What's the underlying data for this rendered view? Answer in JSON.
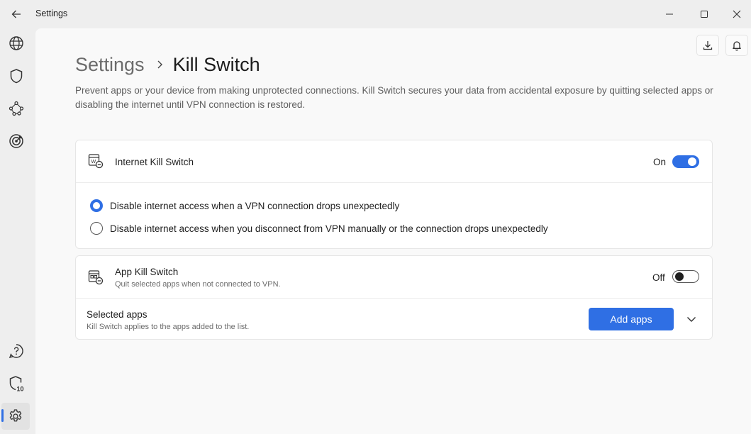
{
  "window": {
    "title": "Settings",
    "back_icon": "arrow-left-icon",
    "controls": [
      "minimize-icon",
      "maximize-icon",
      "close-icon"
    ]
  },
  "rail": {
    "top_items": [
      "globe-icon",
      "shield-icon",
      "mesh-network-icon",
      "target-icon"
    ],
    "bottom_items": [
      "help-icon",
      "shield-10-icon",
      "gear-icon"
    ],
    "shield_badge": "10",
    "active": "gear-icon"
  },
  "toolbar": {
    "buttons": [
      "download-icon",
      "bell-icon"
    ]
  },
  "breadcrumb": {
    "parent": "Settings",
    "current": "Kill Switch"
  },
  "description": "Prevent apps or your device from making unprotected connections. Kill Switch secures your data from accidental exposure by quitting selected apps or disabling the internet until VPN connection is restored.",
  "internet_kill_switch": {
    "title": "Internet Kill Switch",
    "state_label": "On",
    "enabled": true,
    "options": [
      {
        "label": "Disable internet access when a VPN connection drops unexpectedly",
        "selected": true
      },
      {
        "label": "Disable internet access when you disconnect from VPN manually or the connection drops unexpectedly",
        "selected": false
      }
    ]
  },
  "app_kill_switch": {
    "title": "App Kill Switch",
    "subtitle": "Quit selected apps when not connected to VPN.",
    "state_label": "Off",
    "enabled": false
  },
  "selected_apps": {
    "title": "Selected apps",
    "subtitle": "Kill Switch applies to the apps added to the list.",
    "button_label": "Add apps"
  },
  "colors": {
    "accent": "#2f6fe4",
    "background": "#eeeeee",
    "panel": "#f9f9f9",
    "card": "#ffffff"
  }
}
